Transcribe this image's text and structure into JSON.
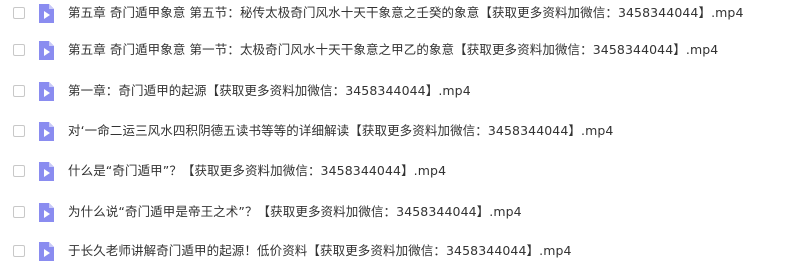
{
  "files": [
    {
      "name": "第五章    奇门遁甲象意  第五节：秘传太极奇门风水十天干象意之壬癸的象意【获取更多资料加微信：3458344044】.mp4",
      "icon": "video-file-icon",
      "checked": false
    },
    {
      "name": "第五章    奇门遁甲象意  第一节：太极奇门风水十天干象意之甲乙的象意【获取更多资料加微信：3458344044】.mp4",
      "icon": "video-file-icon",
      "checked": false
    },
    {
      "name": "第一章：奇门遁甲的起源【获取更多资料加微信：3458344044】.mp4",
      "icon": "video-file-icon",
      "checked": false
    },
    {
      "name": "对‘一命二运三风水四积阴德五读书等等的详细解读【获取更多资料加微信：3458344044】.mp4",
      "icon": "video-file-icon",
      "checked": false
    },
    {
      "name": "什么是“奇门遁甲”？【获取更多资料加微信：3458344044】.mp4",
      "icon": "video-file-icon",
      "checked": false
    },
    {
      "name": "为什么说“奇门遁甲是帝王之术”？【获取更多资料加微信：3458344044】.mp4",
      "icon": "video-file-icon",
      "checked": false
    },
    {
      "name": "于长久老师讲解奇门遁甲的起源！低价资料【获取更多资料加微信：3458344044】.mp4",
      "icon": "video-file-icon",
      "checked": false
    }
  ],
  "colors": {
    "icon_body": "#8a8cf0",
    "icon_fold": "#c9caf8",
    "icon_play": "#ffffff",
    "text": "#333333",
    "checkbox_border": "#c8c8c8"
  }
}
